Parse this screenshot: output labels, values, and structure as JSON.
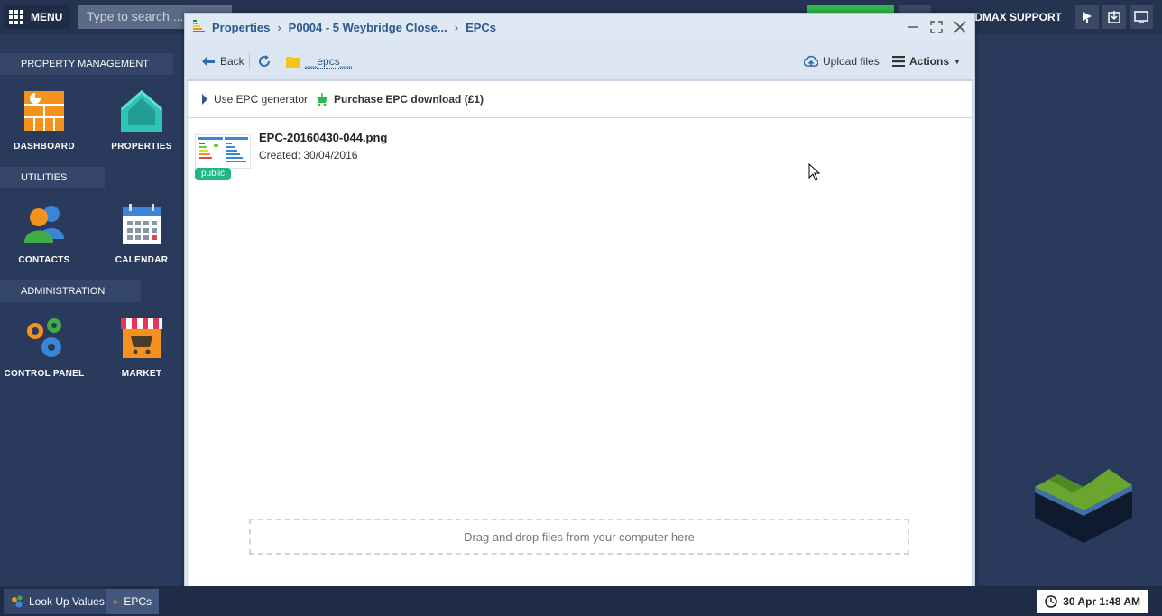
{
  "topbar": {
    "menu_label": "MENU",
    "search_placeholder": "Type to search ...",
    "support_label": "IDMAX SUPPORT"
  },
  "sidebar": {
    "sections": [
      {
        "title": "PROPERTY MANAGEMENT"
      },
      {
        "title": "UTILITIES"
      },
      {
        "title": "ADMINISTRATION"
      }
    ],
    "tiles": [
      {
        "label": "DASHBOARD"
      },
      {
        "label": "PROPERTIES"
      },
      {
        "label": "CONTACTS"
      },
      {
        "label": "CALENDAR"
      },
      {
        "label": "CONTROL PANEL"
      },
      {
        "label": "MARKET"
      }
    ]
  },
  "dialog": {
    "breadcrumb": [
      "Properties",
      "P0004 - 5 Weybridge Close...",
      "EPCs"
    ],
    "toolbar": {
      "back_label": "Back",
      "folder_label": "__epcs__",
      "upload_label": "Upload files",
      "actions_label": "Actions"
    },
    "subbar": {
      "generator_label": "Use EPC generator",
      "purchase_label": "Purchase EPC download (£1)"
    },
    "files": [
      {
        "name": "EPC-20160430-044.png",
        "created": "Created: 30/04/2016",
        "badge": "public"
      }
    ],
    "dropzone_text": "Drag and drop files from your computer here"
  },
  "taskbar": {
    "tasks": [
      {
        "label": "Look Up Values"
      },
      {
        "label": "EPCs"
      }
    ],
    "clock": "30 Apr 1:48 AM"
  },
  "colors": {
    "background": "#2a3a5c",
    "accent_blue": "#2d5a8e",
    "badge_green": "#21b58a",
    "dashboard_orange": "#f5921e",
    "properties_teal": "#2ec4b6"
  }
}
